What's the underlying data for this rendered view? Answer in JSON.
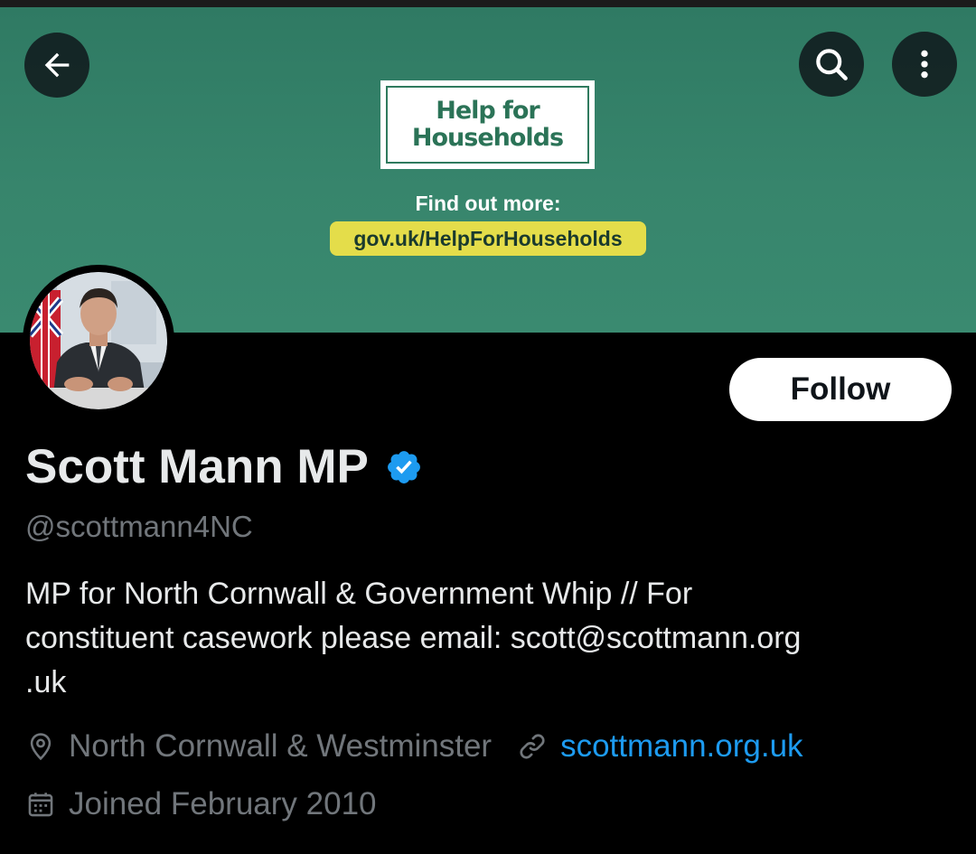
{
  "header": {
    "back_icon": "arrow-left-icon",
    "search_icon": "search-icon",
    "more_icon": "more-vertical-icon"
  },
  "banner": {
    "logo_text": "Help for Households",
    "find_out_more": "Find out more:",
    "link": "gov.uk/HelpForHouseholds",
    "background_color": "#37856c",
    "link_highlight_color": "#e4dd4a"
  },
  "profile": {
    "follow_label": "Follow",
    "display_name": "Scott Mann MP",
    "handle": "@scottmann4NC",
    "bio": "MP for North Cornwall & Government Whip // For\nconstituent casework please email: scott@scottmann.org\n.uk",
    "location": "North Cornwall & Westminster",
    "website": "scottmann.org.uk",
    "joined": "Joined February 2010",
    "verified_color": "#1d9bf0"
  }
}
